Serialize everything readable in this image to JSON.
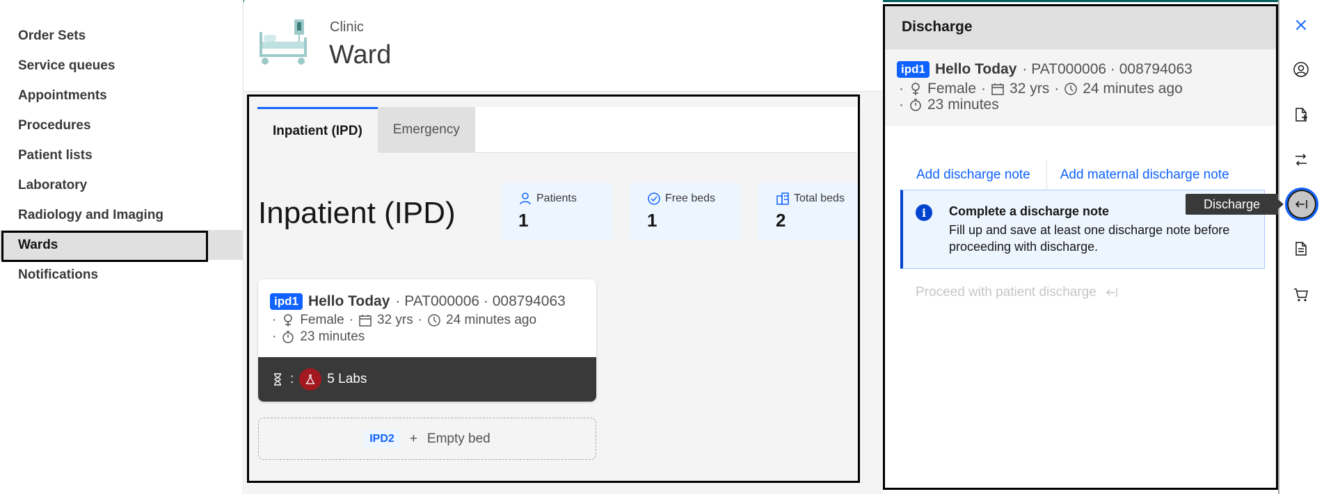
{
  "nav": {
    "items": [
      {
        "label": "Order Sets",
        "active": false
      },
      {
        "label": "Service queues",
        "active": false
      },
      {
        "label": "Appointments",
        "active": false
      },
      {
        "label": "Procedures",
        "active": false
      },
      {
        "label": "Patient lists",
        "active": false
      },
      {
        "label": "Laboratory",
        "active": false
      },
      {
        "label": "Radiology and Imaging",
        "active": false
      },
      {
        "label": "Wards",
        "active": true
      },
      {
        "label": "Notifications",
        "active": false
      }
    ]
  },
  "header": {
    "location": "Clinic",
    "title": "Ward",
    "illustration": "hospital-bed-icon"
  },
  "tabs": [
    {
      "label": "Inpatient (IPD)",
      "selected": true
    },
    {
      "label": "Emergency",
      "selected": false
    }
  ],
  "ward": {
    "title": "Inpatient (IPD)",
    "stats": [
      {
        "label": "Patients",
        "value": "1",
        "icon": "user-icon"
      },
      {
        "label": "Free beds",
        "value": "1",
        "icon": "check-circle-icon"
      },
      {
        "label": "Total beds",
        "value": "2",
        "icon": "building-icon"
      }
    ]
  },
  "bed_card": {
    "bed_tag": "ipd1",
    "patient_name": "Hello Today",
    "patient_ids": "· PAT000006 · 008794063",
    "gender": "Female",
    "age": "32 yrs",
    "admitted": "24 minutes ago",
    "duration": "23 minutes",
    "pending_label": ":",
    "labs": "5 Labs"
  },
  "empty_bed": {
    "tag": "IPD2",
    "label": "Empty bed"
  },
  "discharge_panel": {
    "title": "Discharge",
    "patient": {
      "bed_tag": "ipd1",
      "name": "Hello Today",
      "ids": "· PAT000006 · 008794063",
      "gender": "Female",
      "age": "32 yrs",
      "admitted": "24 minutes ago",
      "duration": "23 minutes"
    },
    "note_tabs": [
      "Add discharge note",
      "Add maternal discharge note"
    ],
    "notice": {
      "title": "Complete a discharge note",
      "body": "Fill up and save at least one discharge note before proceeding with discharge."
    },
    "proceed_label": "Proceed with patient discharge"
  },
  "rail": {
    "tooltip": "Discharge",
    "buttons": [
      "close-icon",
      "patient-icon",
      "note-add-icon",
      "transfer-icon",
      "discharge-icon",
      "document-icon",
      "cart-icon"
    ]
  },
  "colors": {
    "accent": "#0f62fe",
    "brand_teal": "#005d5d",
    "lab_badge": "#a2191f"
  }
}
